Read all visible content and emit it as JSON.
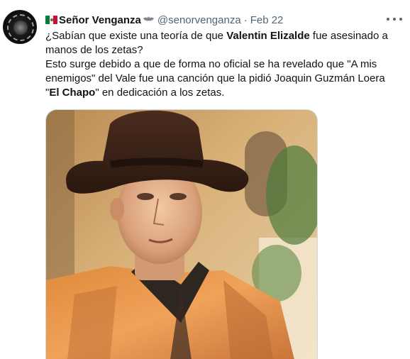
{
  "tweet": {
    "author_name": "Señor Venganza",
    "handle": "@senorvenganza",
    "separator": "·",
    "date": "Feb 22",
    "text": {
      "l1_a": "¿Sabían que existe una teoría de que ",
      "l1_bold": "Valentin Elizalde",
      "l1_b": " fue asesinado a",
      "l2": "manos de los zetas?",
      "l3": "Esto surge debido a que de forma no oficial se ha revelado que \"A mis",
      "l4": "enemigos\" del Vale fue una canción que la pidió Joaquin Guzmán Loera",
      "l5_a": "\"",
      "l5_bold": "El Chapo",
      "l5_b": "\" en dedicación a los zetas."
    },
    "icons": {
      "flag": "mexico-flag-icon",
      "bat": "bat-icon",
      "more": "more-options-icon",
      "avatar": "avatar"
    },
    "colors": {
      "text": "#0f1419",
      "secondary": "#536471",
      "border": "#cfd9de"
    }
  }
}
